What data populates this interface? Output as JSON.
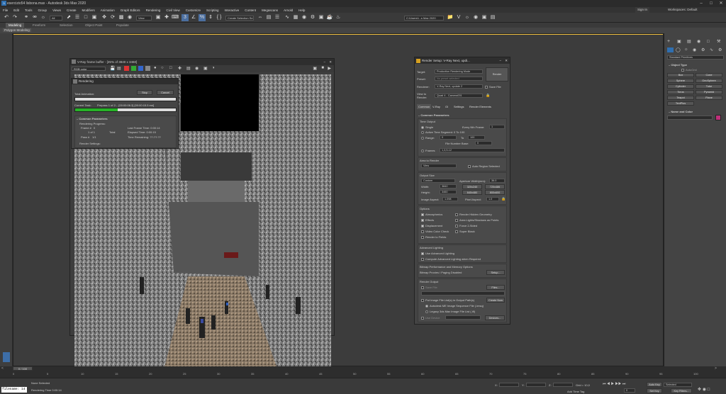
{
  "window": {
    "title": "esercizio54 lisbona.max - Autodesk 3ds Max 2020"
  },
  "menu": [
    "File",
    "Edit",
    "Tools",
    "Group",
    "Views",
    "Create",
    "Modifiers",
    "Animation",
    "Graph Editors",
    "Rendering",
    "Civil View",
    "Customize",
    "Scripting",
    "Interactive",
    "Content",
    "Megascans",
    "Arnold",
    "Help"
  ],
  "account": {
    "signin": "Sign In",
    "workspaces_label": "Workspaces:",
    "workspace": "Default"
  },
  "toolbar": {
    "selection_set": "Create Selection Se",
    "view_dropdown": "View",
    "path_dropdown": "C:\\Users\\l...s Max 2020"
  },
  "ribbon": {
    "tabs": [
      "Modeling",
      "Freeform",
      "Selection",
      "Object Paint",
      "Populate"
    ],
    "sub": "Polygon Modeling"
  },
  "vfb": {
    "title": "V-Ray frame buffer - [25% of 3840 x 3460]",
    "channel": "RGB color",
    "status_text": "Prepass 1 of 2... [00:00:06.3] [00:00:15.5 est]"
  },
  "rendering_dialog": {
    "title": "Rendering",
    "stop": "Stop",
    "cancel": "Cancel",
    "total_animation": "Total Animation:",
    "current_task_label": "Current Task:",
    "current_task": "Prepass 1 of 2... [00:00:06.3] [00:00:15.5 est]",
    "progress": 0.42,
    "common_params": "Common Parameters",
    "rendering_progress": "Rendering Progress:",
    "frame_label": "Frame #",
    "frame_value": "0",
    "of_label": "1 of 1",
    "total": "Total",
    "pass_label": "Pass #",
    "pass_value": "1/1",
    "last_frame_time": "Last Frame Time: 0:00:14",
    "elapsed_time": "Elapsed Time: 0:00:15",
    "time_remaining": "Time Remaining: ??:??:??",
    "render_settings": "Render Settings:"
  },
  "render_setup": {
    "title": "Render Setup: V-Ray Next, updi...",
    "target_label": "Target:",
    "target": "Production Rendering Mode",
    "preset_label": "Preset:",
    "preset": "No preset selected",
    "renderer_label": "Renderer:",
    "renderer": "V-Ray Next, update 2",
    "save_file": "Save File",
    "view_label": "View to Render:",
    "view": "Quad 4 - Camera001",
    "render_btn": "Render",
    "tabs": [
      "Common",
      "V-Ray",
      "GI",
      "Settings",
      "Render Elements"
    ],
    "common_params": "Common Parameters",
    "time_output": "Time Output",
    "single": "Single",
    "every_nth": "Every Nth Frame:",
    "every_nth_val": "1",
    "active_segment": "Active Time Segment:",
    "active_segment_val": "0 To 100",
    "range": "Range:",
    "range_from": "0",
    "range_to_label": "To",
    "range_to": "100",
    "file_number_base": "File Number Base:",
    "file_number_base_val": "0",
    "frames": "Frames",
    "frames_val": "1,3,5-12",
    "area_to_render": "Area to Render",
    "area": "View",
    "auto_region": "Auto Region Selected",
    "output_size": "Output Size",
    "size_preset": "Custom",
    "aperture": "Aperture Width(mm):",
    "aperture_val": "36.0",
    "width_label": "Width:",
    "width": "3840",
    "height_label": "Height:",
    "height": "3460",
    "presets": [
      "320x240",
      "720x486",
      "640x480",
      "800x600"
    ],
    "image_aspect": "Image Aspect:",
    "image_aspect_val": "1.098",
    "pixel_aspect": "Pixel Aspect:",
    "pixel_aspect_val": "1.0",
    "options": "Options",
    "opt_items": [
      "Atmospherics",
      "Render Hidden Geometry",
      "Effects",
      "Area Lights/Shadows as Points",
      "Displacement",
      "Force 2-Sided",
      "Video Color Check",
      "Super Black",
      "Render to Fields"
    ],
    "adv_lighting": "Advanced Lighting",
    "use_adv": "Use Advanced Lighting",
    "compute_adv": "Compute Advanced Lighting when Required",
    "bitmap_perf": "Bitmap Performance and Memory Options",
    "bitmap_proxies": "Bitmap Proxies / Paging Disabled",
    "setup_btn": "Setup...",
    "render_output": "Render Output",
    "save_file_chk": "Save File",
    "files_btn": "Files...",
    "put_image": "Put Image File List(s) in Output Path(s)",
    "create_now": "Create Now",
    "autodesk_seq": "Autodesk ME Image Sequence File (.imsq)",
    "legacy": "Legacy 3ds Max Image File List (.ifl)",
    "use_device": "Use Device",
    "devices": "Devices..."
  },
  "command_panel": {
    "category": "Standard Primitives",
    "object_type": "Object Type",
    "autogrid": "AutoGrid",
    "buttons": [
      "Box",
      "Cone",
      "Sphere",
      "GeoSphere",
      "Cylinder",
      "Tube",
      "Torus",
      "Pyramid",
      "Teapot",
      "Plane",
      "TextPlus"
    ],
    "name_color": "Name and Color",
    "color": "#c0307a"
  },
  "timeline": {
    "frame_readout": "0 / 100",
    "ticks": [
      "0",
      "5",
      "10",
      "15",
      "20",
      "25",
      "30",
      "35",
      "40",
      "45",
      "50",
      "55",
      "60",
      "65",
      "70",
      "75",
      "80",
      "85",
      "90",
      "95",
      "100"
    ]
  },
  "status": {
    "maxscript": "filename: 14",
    "selection": "None Selected",
    "render_time": "Rendering Time 0:00:14",
    "x_label": "X:",
    "y_label": "Y:",
    "z_label": "Z:",
    "grid": "Grid = 10,0",
    "add_time_tag": "Add Time Tag",
    "auto_key": "Auto Key",
    "selected": "Selected",
    "set_key": "Set Key",
    "key_filters": "Key Filters...",
    "frame": "0"
  }
}
